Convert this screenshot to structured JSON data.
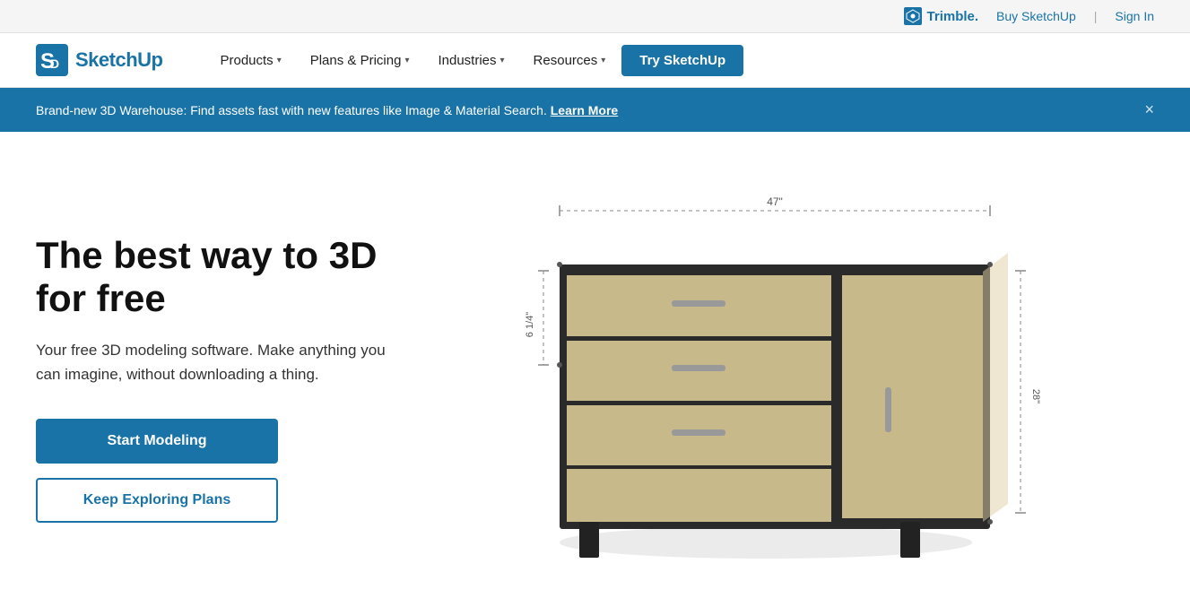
{
  "topbar": {
    "buy_label": "Buy SketchUp",
    "signin_label": "Sign In"
  },
  "nav": {
    "trimble_label": "Trimble",
    "logo_label": "SketchUp",
    "items": [
      {
        "label": "Products",
        "id": "products"
      },
      {
        "label": "Plans & Pricing",
        "id": "plans"
      },
      {
        "label": "Industries",
        "id": "industries"
      },
      {
        "label": "Resources",
        "id": "resources"
      }
    ],
    "cta_label": "Try SketchUp"
  },
  "banner": {
    "text": "Brand-new 3D Warehouse: Find assets fast with new features like Image & Material Search.",
    "link_label": "Learn More",
    "close_label": "×"
  },
  "hero": {
    "title": "The best way to 3D for free",
    "subtitle": "Your free 3D modeling software. Make anything you can imagine, without downloading a thing.",
    "btn_primary": "Start Modeling",
    "btn_secondary": "Keep Exploring Plans"
  },
  "dresser": {
    "dimension_width": "47\"",
    "dimension_height": "6 1/4\"",
    "dimension_depth": "28\""
  }
}
